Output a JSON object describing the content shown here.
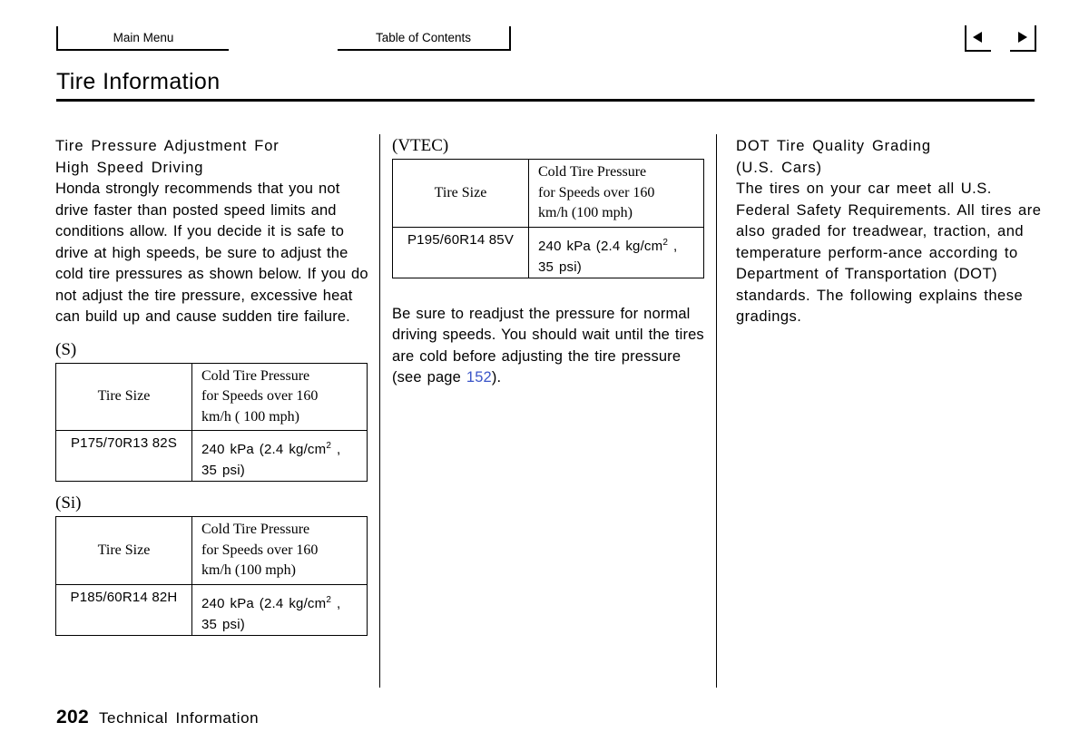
{
  "header": {
    "main_menu_label": "Main Menu",
    "toc_label": "Table of Contents",
    "prev_icon": "triangle-left-icon",
    "next_icon": "triangle-right-icon"
  },
  "page_title": "Tire Information",
  "left_column": {
    "heading_line1": "Tire  Pressure  Adjustment  For",
    "heading_line2": "High  Speed  Driving",
    "paragraph": "Honda strongly recommends that you not drive faster than posted speed limits and conditions allow. If you decide it is safe to drive at high speeds, be sure to adjust the cold tire pressures as shown below. If you do not adjust the tire pressure, excessive heat can build up and cause sudden tire failure.",
    "table_s": {
      "caption": "(S)",
      "header_size": "Tire Size",
      "header_pressure_line1": "Cold Tire Pressure",
      "header_pressure_line2": "for Speeds over 160",
      "header_pressure_line3": "km/h ( 100 mph)",
      "value_size": "P175/70R13 82S",
      "value_pressure_line1_a": "240  kPa (2.4  kg/cm",
      "value_pressure_line1_sup": "2",
      "value_pressure_line1_b": " ,",
      "value_pressure_line2": "35  psi)"
    },
    "table_si": {
      "caption": "(Si)",
      "header_size": "Tire Size",
      "header_pressure_line1": "Cold Tire Pressure",
      "header_pressure_line2": "for Speeds over 160",
      "header_pressure_line3": "km/h (100 mph)",
      "value_size": "P185/60R14 82H",
      "value_pressure_line1_a": "240  kPa (2.4  kg/cm",
      "value_pressure_line1_sup": "2",
      "value_pressure_line1_b": " ,",
      "value_pressure_line2": "35  psi)"
    }
  },
  "middle_column": {
    "table_vtec": {
      "caption": "(VTEC)",
      "header_size": "Tire Size",
      "header_pressure_line1": "Cold Tire Pressure",
      "header_pressure_line2": "for Speeds over 160",
      "header_pressure_line3": "km/h (100 mph)",
      "value_size": "P195/60R14 85V",
      "value_pressure_line1_a": "240  kPa (2.4  kg/cm",
      "value_pressure_line1_sup": "2",
      "value_pressure_line1_b": " ,",
      "value_pressure_line2": "35  psi)"
    },
    "paragraph_before_link": "Be sure to readjust the pressure for normal driving speeds. You should wait until the tires are cold before adjusting the tire pressure (see page ",
    "page_link": "152",
    "paragraph_after_link": ")."
  },
  "right_column": {
    "heading_line1": "DOT Tire Quality Grading",
    "heading_line2": "(U.S. Cars)",
    "paragraph": "The tires on your car meet all U.S. Federal Safety Requirements. All tires are also graded for treadwear, traction, and temperature perform-ance according to Department of Transportation  (DOT)  standards. The following explains these gradings."
  },
  "footer": {
    "page_number": "202",
    "section_label": "Technical  Information"
  },
  "colors": {
    "link": "#3a55c8",
    "text": "#000000",
    "background": "#ffffff"
  }
}
